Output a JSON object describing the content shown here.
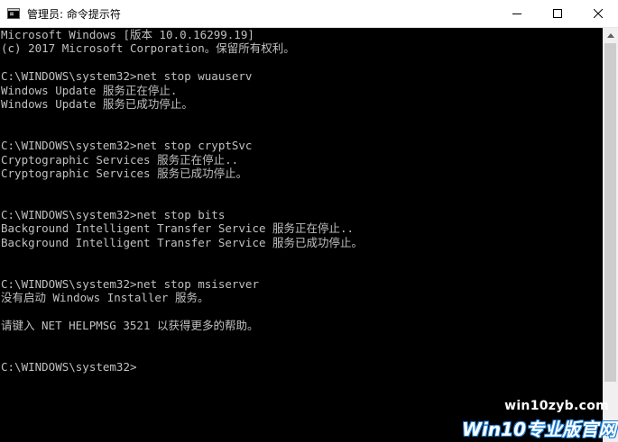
{
  "window": {
    "title": "管理员: 命令提示符",
    "minimize_glyph": "—",
    "maximize_glyph": "☐",
    "close_glyph": "✕"
  },
  "console": {
    "lines": [
      "Microsoft Windows [版本 10.0.16299.19]",
      "(c) 2017 Microsoft Corporation。保留所有权利。",
      "",
      "C:\\WINDOWS\\system32>net stop wuauserv",
      "Windows Update 服务正在停止.",
      "Windows Update 服务已成功停止。",
      "",
      "",
      "C:\\WINDOWS\\system32>net stop cryptSvc",
      "Cryptographic Services 服务正在停止..",
      "Cryptographic Services 服务已成功停止。",
      "",
      "",
      "C:\\WINDOWS\\system32>net stop bits",
      "Background Intelligent Transfer Service 服务正在停止..",
      "Background Intelligent Transfer Service 服务已成功停止。",
      "",
      "",
      "C:\\WINDOWS\\system32>net stop msiserver",
      "没有启动 Windows Installer 服务。",
      "",
      "请键入 NET HELPMSG 3521 以获得更多的帮助。",
      "",
      "",
      "C:\\WINDOWS\\system32>"
    ]
  },
  "watermark": {
    "url": "win10zyb.com",
    "brand": "Win10专业版官网"
  },
  "colors": {
    "console_bg": "#000000",
    "console_text": "#c0c0c0",
    "titlebar_bg": "#ffffff",
    "scrollbar_bg": "#f0f0f0",
    "scroll_thumb": "#cdcdcd",
    "watermark_accent": "#1f7fd6"
  }
}
